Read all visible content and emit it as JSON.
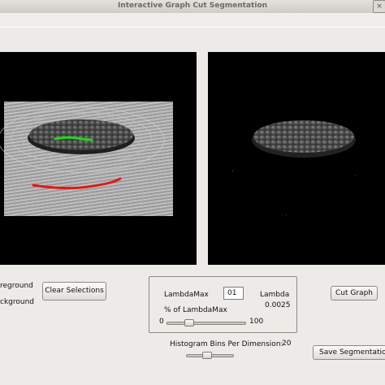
{
  "window": {
    "title": "Interactive Graph Cut Segmentation",
    "close_glyph": "×"
  },
  "left_panel": {
    "foreground_label": "reground",
    "background_label": "ckground",
    "clear_button": "Clear Selections",
    "foreground_stroke_color": "#1ed81e",
    "background_stroke_color": "#e01818"
  },
  "lambda_group": {
    "lambdamax_label": "LambdaMax",
    "lambdamax_value": "01",
    "lambda_label": "Lambda",
    "lambda_value": "0.0025",
    "percent_label": "% of LambdaMax",
    "slider_min": "0",
    "slider_max": "100",
    "slider_percent": 25
  },
  "actions": {
    "cut_button": "Cut Graph",
    "save_button": "Save Segmentation"
  },
  "histogram": {
    "label": "Histogram Bins Per Dimension:",
    "value": "20"
  }
}
